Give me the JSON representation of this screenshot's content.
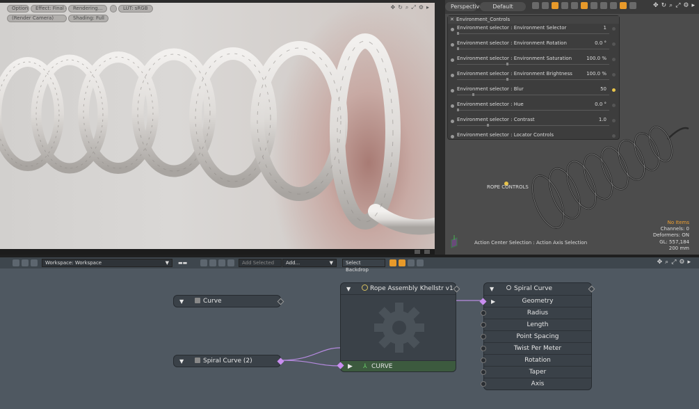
{
  "render": {
    "options": "Options",
    "effect": "Effect: Final C...",
    "rendering": "Rendering...",
    "lut": "LUT: sRGB",
    "camera": "(Render Camera)",
    "shading": "Shading: Full"
  },
  "gl": {
    "view": "Perspective",
    "style": "Default",
    "panel_title": "Environment_Controls",
    "rows": [
      {
        "label": "Environment selector : Environment Selector",
        "value": "1",
        "knob": 0.0
      },
      {
        "label": "Environment selector : Environment Rotation",
        "value": "0.0 °",
        "knob": 0.0
      },
      {
        "label": "Environment selector : Environment Saturation",
        "value": "100.0 %",
        "knob": 0.33
      },
      {
        "label": "Environment selector : Environment Brightness",
        "value": "100.0 %",
        "knob": 0.33
      },
      {
        "label": "Environment selector : Blur",
        "value": "50",
        "knob": 0.1
      },
      {
        "label": "Environment selector : Hue",
        "value": "0.0 °",
        "knob": 0.0
      },
      {
        "label": "Environment selector : Contrast",
        "value": "1.0",
        "knob": 0.2
      },
      {
        "label": "Environment selector : Locator Controls",
        "value": "",
        "knob": null
      }
    ],
    "rope_label": "ROPE CONTROLS",
    "status": {
      "no_items": "No Items",
      "channels": "Channels: 0",
      "deformers": "Deformers: ON",
      "gl": "GL: 557,184",
      "size": "200 mm"
    },
    "action_center": "Action Center Selection : Action Axis Selection"
  },
  "schematic": {
    "workspace": "Workspace: Workspace",
    "add_selected": "Add Selected",
    "add": "Add...",
    "select_backdrop": "Select Backdrop",
    "nodes": {
      "curve": "Curve",
      "spiral_curve_2": "Spiral Curve (2)",
      "rope_assembly": "Rope Assembly Khellstr v1",
      "rope_curve_port": "CURVE",
      "spiral_curve": "Spiral Curve",
      "spiral_inputs": [
        "Geometry",
        "Radius",
        "Length",
        "Point Spacing",
        "Twist Per Meter",
        "Rotation",
        "Taper",
        "Axis"
      ]
    }
  },
  "colors": {
    "accent": "#e89a2a",
    "link": "#c98ef0",
    "status_warning": "#f0a030",
    "schematic_bg": "#4f5861"
  }
}
